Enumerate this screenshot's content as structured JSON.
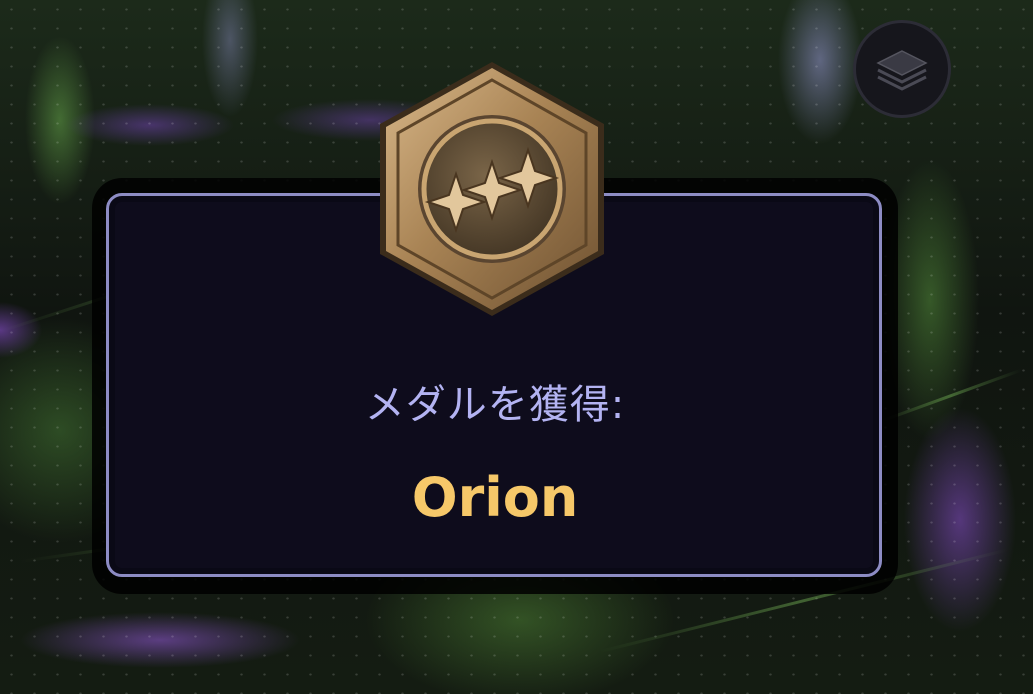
{
  "game_view": {
    "layers_button_icon": "layers-icon"
  },
  "medal_dialog": {
    "label": "メダルを獲得:",
    "medal_name": "Orion",
    "medal_icon": "three-stars-medal-icon"
  },
  "colors": {
    "dialog_background": "#0e0c1c",
    "dialog_border": "#8d8cc4",
    "label_text": "#b3b3f2",
    "medal_name_text": "#f6c869",
    "medal_bronze": "#b08a5a"
  }
}
